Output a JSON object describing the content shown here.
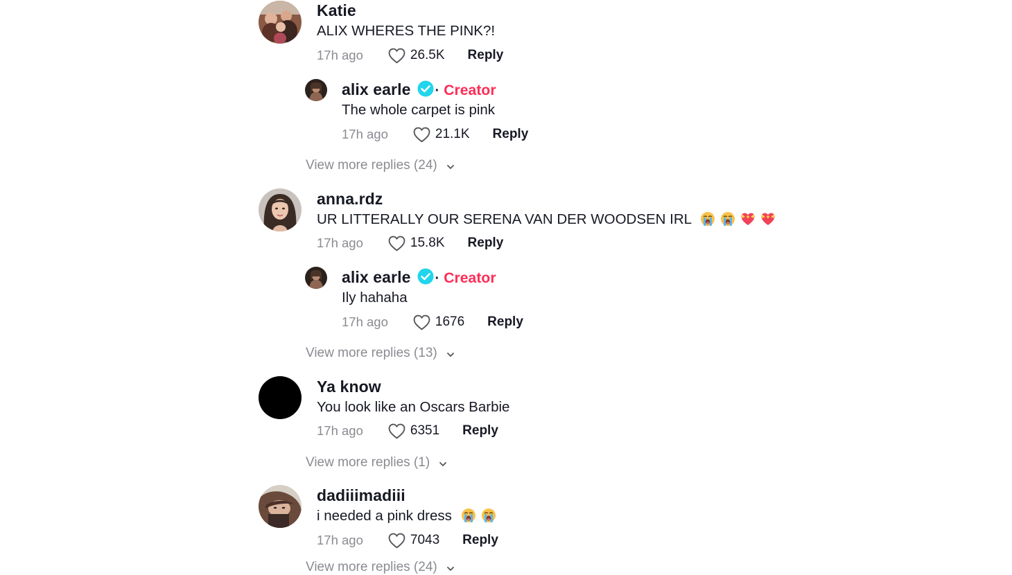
{
  "comments": [
    {
      "author": "Katie",
      "text": "ALIX WHERES THE PINK?!",
      "time": "17h ago",
      "likes": "26.5K",
      "reply_label": "Reply",
      "avatar_icon": "group-photo-avatar",
      "reply": {
        "author": "alix earle",
        "badge_label": "Creator",
        "text": "The whole carpet is pink",
        "time": "17h ago",
        "likes": "21.1K",
        "reply_label": "Reply"
      },
      "view_more": "View more replies (24)"
    },
    {
      "author": "anna.rdz",
      "text": "UR LITTERALLY OUR SERENA VAN DER WOODSEN IRL",
      "emojis": [
        "loudly-crying-face",
        "loudly-crying-face",
        "heart-with-ribbon",
        "heart-with-ribbon"
      ],
      "time": "17h ago",
      "likes": "15.8K",
      "reply_label": "Reply",
      "avatar_icon": "portrait-avatar",
      "reply": {
        "author": "alix earle",
        "badge_label": "Creator",
        "text": "Ily hahaha",
        "time": "17h ago",
        "likes": "1676",
        "reply_label": "Reply"
      },
      "view_more": "View more replies (13)"
    },
    {
      "author": "Ya know",
      "text": "You look like an Oscars Barbie",
      "time": "17h ago",
      "likes": "6351",
      "reply_label": "Reply",
      "avatar_icon": "black-circle-avatar",
      "view_more": "View more replies (1)"
    },
    {
      "author": "dadiiimadiii",
      "text": "i needed a pink dress",
      "emojis": [
        "loudly-crying-face",
        "loudly-crying-face"
      ],
      "time": "17h ago",
      "likes": "7043",
      "reply_label": "Reply",
      "avatar_icon": "photo-avatar",
      "view_more": "View more replies (24)"
    }
  ],
  "colors": {
    "creator_badge": "#fe2c55",
    "verified_badge": "#20d5ec",
    "muted_text": "#8a8b91",
    "primary_text": "#161823"
  }
}
